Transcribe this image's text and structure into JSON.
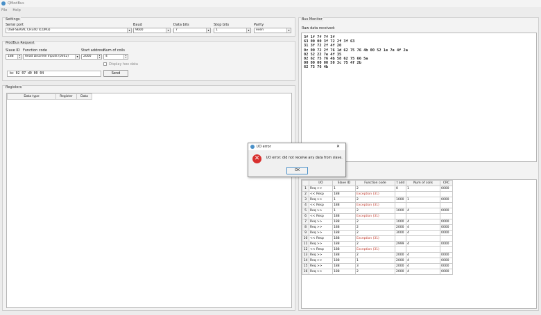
{
  "window": {
    "title": "QModBus"
  },
  "menu": [
    "File",
    "Help"
  ],
  "settings": {
    "title": "Settings",
    "serial_port_label": "Serial port",
    "serial_port_value": "USB-SERIAL CH340 (COM3)",
    "baud_label": "Baud",
    "baud_value": "9600",
    "data_bits_label": "Data bits",
    "data_bits_value": "7",
    "stop_bits_label": "Stop bits",
    "stop_bits_value": "1",
    "parity_label": "Parity",
    "parity_value": "even"
  },
  "request": {
    "title": "ModBus Request",
    "slave_id_label": "Slave ID",
    "slave_id_value": "188",
    "function_code_label": "Function code",
    "function_code_value": "Read Discrete Inputs (0x02)",
    "start_address_label": "Start address",
    "start_address_value": "2000",
    "num_coils_label": "Num of coils",
    "num_coils_value": "4",
    "display_hex_label": "Display hex data",
    "raw_request": "bc  02  07  d0  00  04",
    "send_label": "Send"
  },
  "registers": {
    "title": "Registers",
    "columns": [
      "Data type",
      "Register",
      "Data"
    ]
  },
  "bus_monitor": {
    "title": "Bus Monitor",
    "raw_label": "Raw data received:",
    "raw_lines": [
      "3f 1f 7f 7f 3f",
      "63 00 00 3f 72 2f 3f 63",
      "31 3f 72 2f 4f 20",
      "0c 00 72 2f 76 1d 62 75 76 4b 00 52 1e 7e 4f 2a",
      "02 52 22 7e 4f 35",
      "02 62 75 76 4b 58 62 75 66 5a",
      "00 00 00 00 50 3c 75 4f 2b",
      "62 75 76 4b"
    ],
    "columns": [
      "I/O",
      "Slave ID",
      "Function code",
      "t add",
      "Num of coils",
      "CRC"
    ],
    "rows": [
      {
        "n": "1",
        "io": "Req >>",
        "slave": "1",
        "func": "2",
        "addr": "0",
        "coils": "1",
        "crc": "0000"
      },
      {
        "n": "2",
        "io": "<< Resp",
        "slave": "188",
        "func": "Exception (31)",
        "addr": "",
        "coils": "",
        "crc": ""
      },
      {
        "n": "3",
        "io": "Req >>",
        "slave": "1",
        "func": "2",
        "addr": "1000",
        "coils": "1",
        "crc": "0000"
      },
      {
        "n": "4",
        "io": "<< Resp",
        "slave": "188",
        "func": "Exception (31)",
        "addr": "",
        "coils": "",
        "crc": ""
      },
      {
        "n": "5",
        "io": "Req >>",
        "slave": "1",
        "func": "2",
        "addr": "1000",
        "coils": "4",
        "crc": "0000"
      },
      {
        "n": "6",
        "io": "<< Resp",
        "slave": "188",
        "func": "Exception (31)",
        "addr": "",
        "coils": "",
        "crc": ""
      },
      {
        "n": "7",
        "io": "Req >>",
        "slave": "188",
        "func": "2",
        "addr": "1000",
        "coils": "4",
        "crc": "0000"
      },
      {
        "n": "8",
        "io": "Req >>",
        "slave": "188",
        "func": "2",
        "addr": "2000",
        "coils": "4",
        "crc": "0000"
      },
      {
        "n": "9",
        "io": "Req >>",
        "slave": "188",
        "func": "2",
        "addr": "3000",
        "coils": "4",
        "crc": "0000"
      },
      {
        "n": "10",
        "io": "<< Resp",
        "slave": "188",
        "func": "Exception (31)",
        "addr": "",
        "coils": "",
        "crc": ""
      },
      {
        "n": "11",
        "io": "Req >>",
        "slave": "188",
        "func": "2",
        "addr": "2999",
        "coils": "4",
        "crc": "0000"
      },
      {
        "n": "12",
        "io": "<< Resp",
        "slave": "188",
        "func": "Exception (31)",
        "addr": "",
        "coils": "",
        "crc": ""
      },
      {
        "n": "13",
        "io": "Req >>",
        "slave": "188",
        "func": "2",
        "addr": "2000",
        "coils": "4",
        "crc": "0000"
      },
      {
        "n": "14",
        "io": "Req >>",
        "slave": "188",
        "func": "1",
        "addr": "2000",
        "coils": "4",
        "crc": "0000"
      },
      {
        "n": "15",
        "io": "Req >>",
        "slave": "188",
        "func": "3",
        "addr": "2000",
        "coils": "4",
        "crc": "0000"
      },
      {
        "n": "16",
        "io": "Req >>",
        "slave": "188",
        "func": "2",
        "addr": "2000",
        "coils": "4",
        "crc": "0000"
      }
    ]
  },
  "dialog": {
    "title": "I/O error",
    "message": "I/O error: did not receive any data from slave.",
    "ok_label": "OK",
    "close_glyph": "✕",
    "icon_glyph": "✕"
  },
  "colors": {
    "exception": "#c0392b",
    "error_icon": "#d8302e"
  }
}
